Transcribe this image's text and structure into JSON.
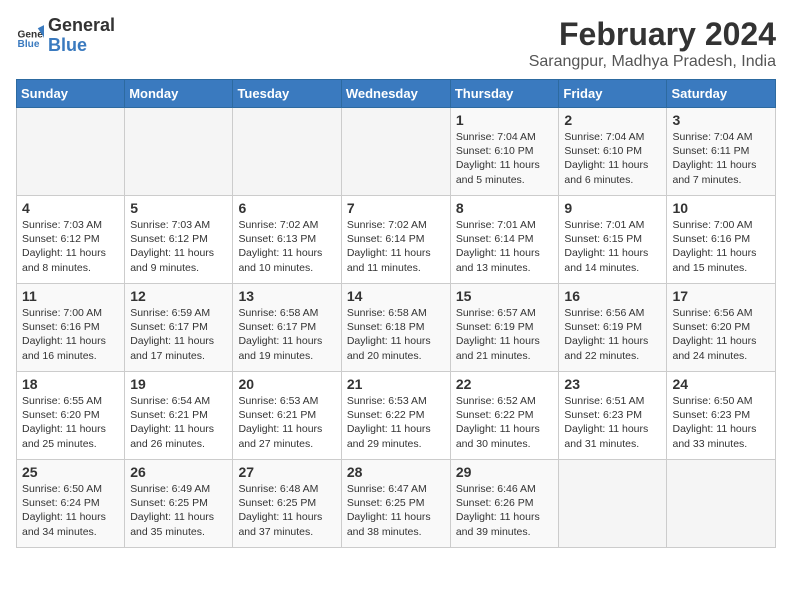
{
  "header": {
    "logo_general": "General",
    "logo_blue": "Blue",
    "month_year": "February 2024",
    "location": "Sarangpur, Madhya Pradesh, India"
  },
  "days_of_week": [
    "Sunday",
    "Monday",
    "Tuesday",
    "Wednesday",
    "Thursday",
    "Friday",
    "Saturday"
  ],
  "weeks": [
    [
      {
        "day": "",
        "info": ""
      },
      {
        "day": "",
        "info": ""
      },
      {
        "day": "",
        "info": ""
      },
      {
        "day": "",
        "info": ""
      },
      {
        "day": "1",
        "info": "Sunrise: 7:04 AM\nSunset: 6:10 PM\nDaylight: 11 hours and 5 minutes."
      },
      {
        "day": "2",
        "info": "Sunrise: 7:04 AM\nSunset: 6:10 PM\nDaylight: 11 hours and 6 minutes."
      },
      {
        "day": "3",
        "info": "Sunrise: 7:04 AM\nSunset: 6:11 PM\nDaylight: 11 hours and 7 minutes."
      }
    ],
    [
      {
        "day": "4",
        "info": "Sunrise: 7:03 AM\nSunset: 6:12 PM\nDaylight: 11 hours and 8 minutes."
      },
      {
        "day": "5",
        "info": "Sunrise: 7:03 AM\nSunset: 6:12 PM\nDaylight: 11 hours and 9 minutes."
      },
      {
        "day": "6",
        "info": "Sunrise: 7:02 AM\nSunset: 6:13 PM\nDaylight: 11 hours and 10 minutes."
      },
      {
        "day": "7",
        "info": "Sunrise: 7:02 AM\nSunset: 6:14 PM\nDaylight: 11 hours and 11 minutes."
      },
      {
        "day": "8",
        "info": "Sunrise: 7:01 AM\nSunset: 6:14 PM\nDaylight: 11 hours and 13 minutes."
      },
      {
        "day": "9",
        "info": "Sunrise: 7:01 AM\nSunset: 6:15 PM\nDaylight: 11 hours and 14 minutes."
      },
      {
        "day": "10",
        "info": "Sunrise: 7:00 AM\nSunset: 6:16 PM\nDaylight: 11 hours and 15 minutes."
      }
    ],
    [
      {
        "day": "11",
        "info": "Sunrise: 7:00 AM\nSunset: 6:16 PM\nDaylight: 11 hours and 16 minutes."
      },
      {
        "day": "12",
        "info": "Sunrise: 6:59 AM\nSunset: 6:17 PM\nDaylight: 11 hours and 17 minutes."
      },
      {
        "day": "13",
        "info": "Sunrise: 6:58 AM\nSunset: 6:17 PM\nDaylight: 11 hours and 19 minutes."
      },
      {
        "day": "14",
        "info": "Sunrise: 6:58 AM\nSunset: 6:18 PM\nDaylight: 11 hours and 20 minutes."
      },
      {
        "day": "15",
        "info": "Sunrise: 6:57 AM\nSunset: 6:19 PM\nDaylight: 11 hours and 21 minutes."
      },
      {
        "day": "16",
        "info": "Sunrise: 6:56 AM\nSunset: 6:19 PM\nDaylight: 11 hours and 22 minutes."
      },
      {
        "day": "17",
        "info": "Sunrise: 6:56 AM\nSunset: 6:20 PM\nDaylight: 11 hours and 24 minutes."
      }
    ],
    [
      {
        "day": "18",
        "info": "Sunrise: 6:55 AM\nSunset: 6:20 PM\nDaylight: 11 hours and 25 minutes."
      },
      {
        "day": "19",
        "info": "Sunrise: 6:54 AM\nSunset: 6:21 PM\nDaylight: 11 hours and 26 minutes."
      },
      {
        "day": "20",
        "info": "Sunrise: 6:53 AM\nSunset: 6:21 PM\nDaylight: 11 hours and 27 minutes."
      },
      {
        "day": "21",
        "info": "Sunrise: 6:53 AM\nSunset: 6:22 PM\nDaylight: 11 hours and 29 minutes."
      },
      {
        "day": "22",
        "info": "Sunrise: 6:52 AM\nSunset: 6:22 PM\nDaylight: 11 hours and 30 minutes."
      },
      {
        "day": "23",
        "info": "Sunrise: 6:51 AM\nSunset: 6:23 PM\nDaylight: 11 hours and 31 minutes."
      },
      {
        "day": "24",
        "info": "Sunrise: 6:50 AM\nSunset: 6:23 PM\nDaylight: 11 hours and 33 minutes."
      }
    ],
    [
      {
        "day": "25",
        "info": "Sunrise: 6:50 AM\nSunset: 6:24 PM\nDaylight: 11 hours and 34 minutes."
      },
      {
        "day": "26",
        "info": "Sunrise: 6:49 AM\nSunset: 6:25 PM\nDaylight: 11 hours and 35 minutes."
      },
      {
        "day": "27",
        "info": "Sunrise: 6:48 AM\nSunset: 6:25 PM\nDaylight: 11 hours and 37 minutes."
      },
      {
        "day": "28",
        "info": "Sunrise: 6:47 AM\nSunset: 6:25 PM\nDaylight: 11 hours and 38 minutes."
      },
      {
        "day": "29",
        "info": "Sunrise: 6:46 AM\nSunset: 6:26 PM\nDaylight: 11 hours and 39 minutes."
      },
      {
        "day": "",
        "info": ""
      },
      {
        "day": "",
        "info": ""
      }
    ]
  ]
}
